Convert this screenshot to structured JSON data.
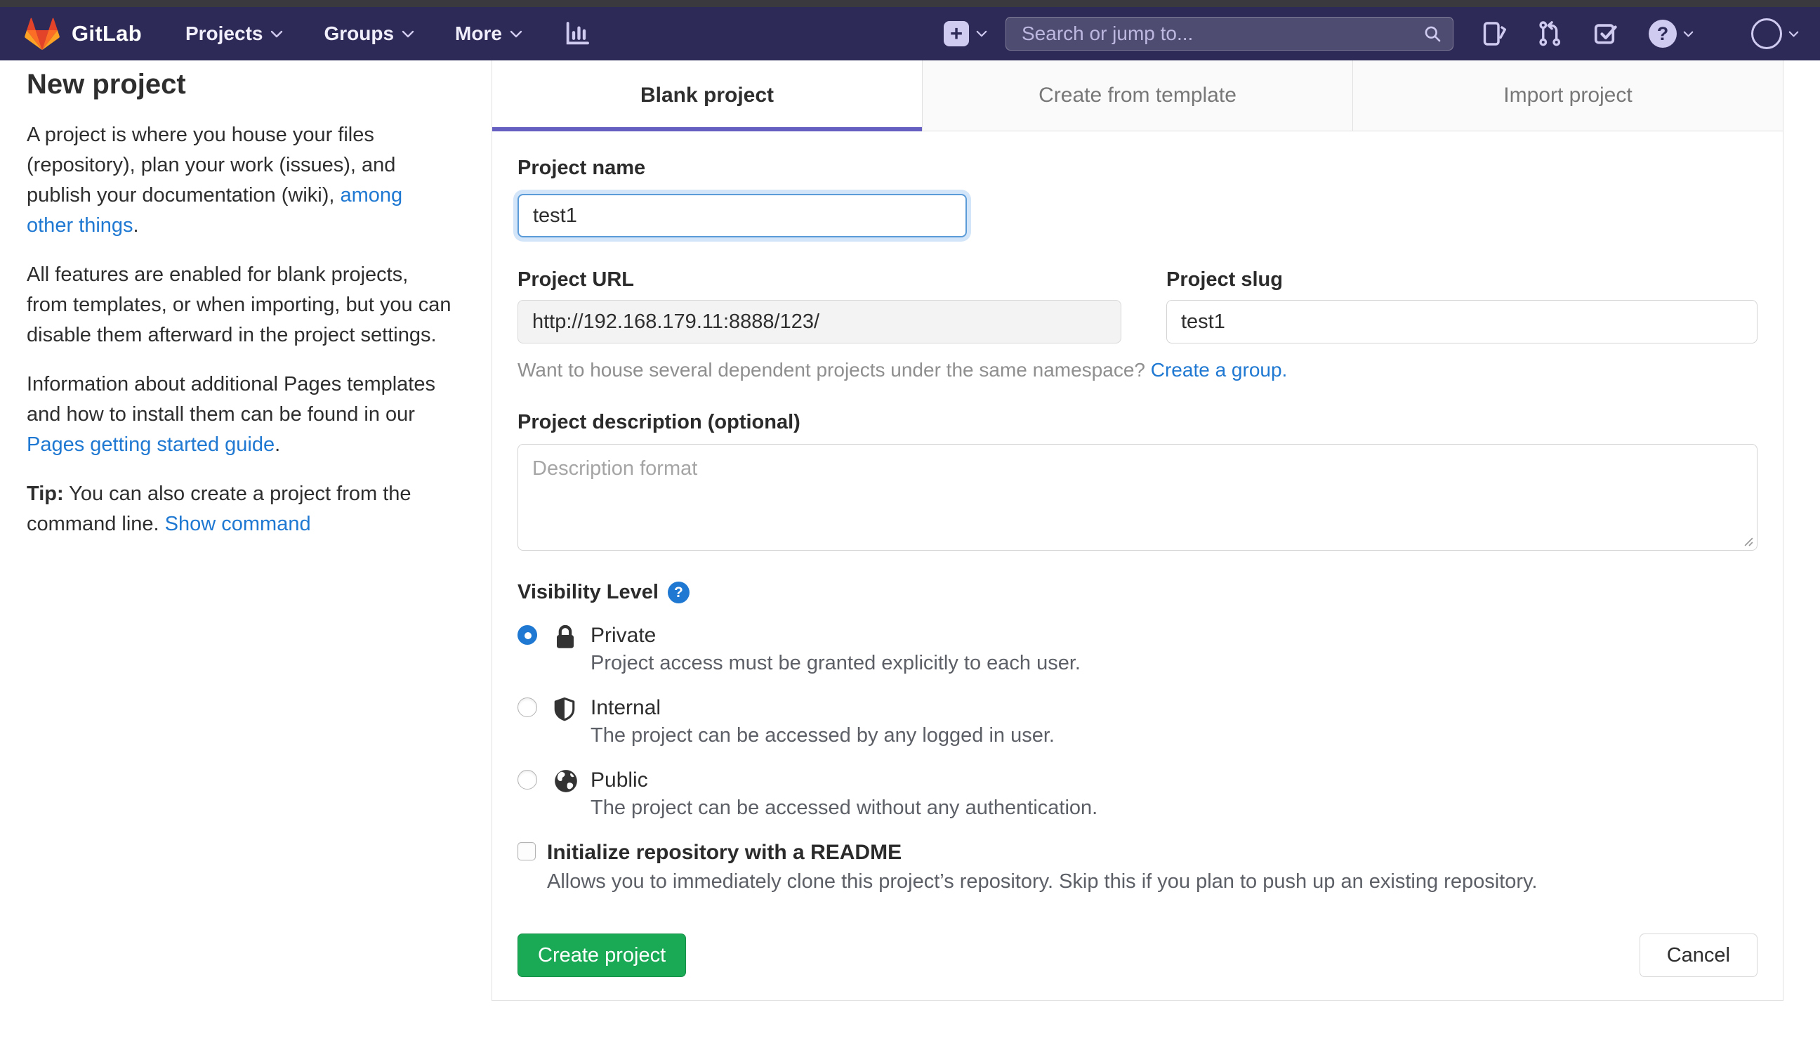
{
  "colors": {
    "navbar_bg": "#2e2a57",
    "navbar_icon": "#cfcaf0",
    "tab_accent": "#655fc2",
    "link_blue": "#1f78d1",
    "button_green": "#1aaa55",
    "logo_red": "#e24329",
    "logo_orange": "#fc6d26",
    "logo_yellow": "#fca326"
  },
  "glyphs": {
    "plus": "+",
    "question_mark": "?"
  },
  "navbar": {
    "brand": "GitLab",
    "menu": [
      "Projects",
      "Groups",
      "More"
    ],
    "search_placeholder": "Search or jump to..."
  },
  "sidebar": {
    "title": "New project",
    "p1": {
      "before": "A project is where you house your files (repository), plan your work (issues), and publish your documentation (wiki), ",
      "link": "among other things",
      "after": "."
    },
    "p2": "All features are enabled for blank projects, from templates, or when importing, but you can disable them afterward in the project settings.",
    "p3": {
      "before": "Information about additional Pages templates and how to install them can be found in our ",
      "link": "Pages getting started guide",
      "after": "."
    },
    "tip": {
      "bold": "Tip:",
      "text": " You can also create a project from the command line. ",
      "link": "Show command"
    }
  },
  "tabs": [
    {
      "label": "Blank project",
      "active": true
    },
    {
      "label": "Create from template",
      "active": false
    },
    {
      "label": "Import project",
      "active": false
    }
  ],
  "form": {
    "project_name": {
      "label": "Project name",
      "value": "test1"
    },
    "project_url": {
      "label": "Project URL",
      "value": "http://192.168.179.11:8888/123/"
    },
    "project_slug": {
      "label": "Project slug",
      "value": "test1"
    },
    "namespace_hint": {
      "text": "Want to house several dependent projects under the same namespace? ",
      "link": "Create a group."
    },
    "description": {
      "label": "Project description (optional)",
      "placeholder": "Description format"
    },
    "visibility": {
      "label": "Visibility Level",
      "options": [
        {
          "name": "Private",
          "desc": "Project access must be granted explicitly to each user.",
          "icon": "lock-icon",
          "selected": true
        },
        {
          "name": "Internal",
          "desc": "The project can be accessed by any logged in user.",
          "icon": "shield-icon",
          "selected": false
        },
        {
          "name": "Public",
          "desc": "The project can be accessed without any authentication.",
          "icon": "globe-icon",
          "selected": false
        }
      ]
    },
    "readme": {
      "label": "Initialize repository with a README",
      "desc": "Allows you to immediately clone this project’s repository. Skip this if you plan to push up an existing repository.",
      "checked": false
    },
    "buttons": {
      "create": "Create project",
      "cancel": "Cancel"
    }
  }
}
